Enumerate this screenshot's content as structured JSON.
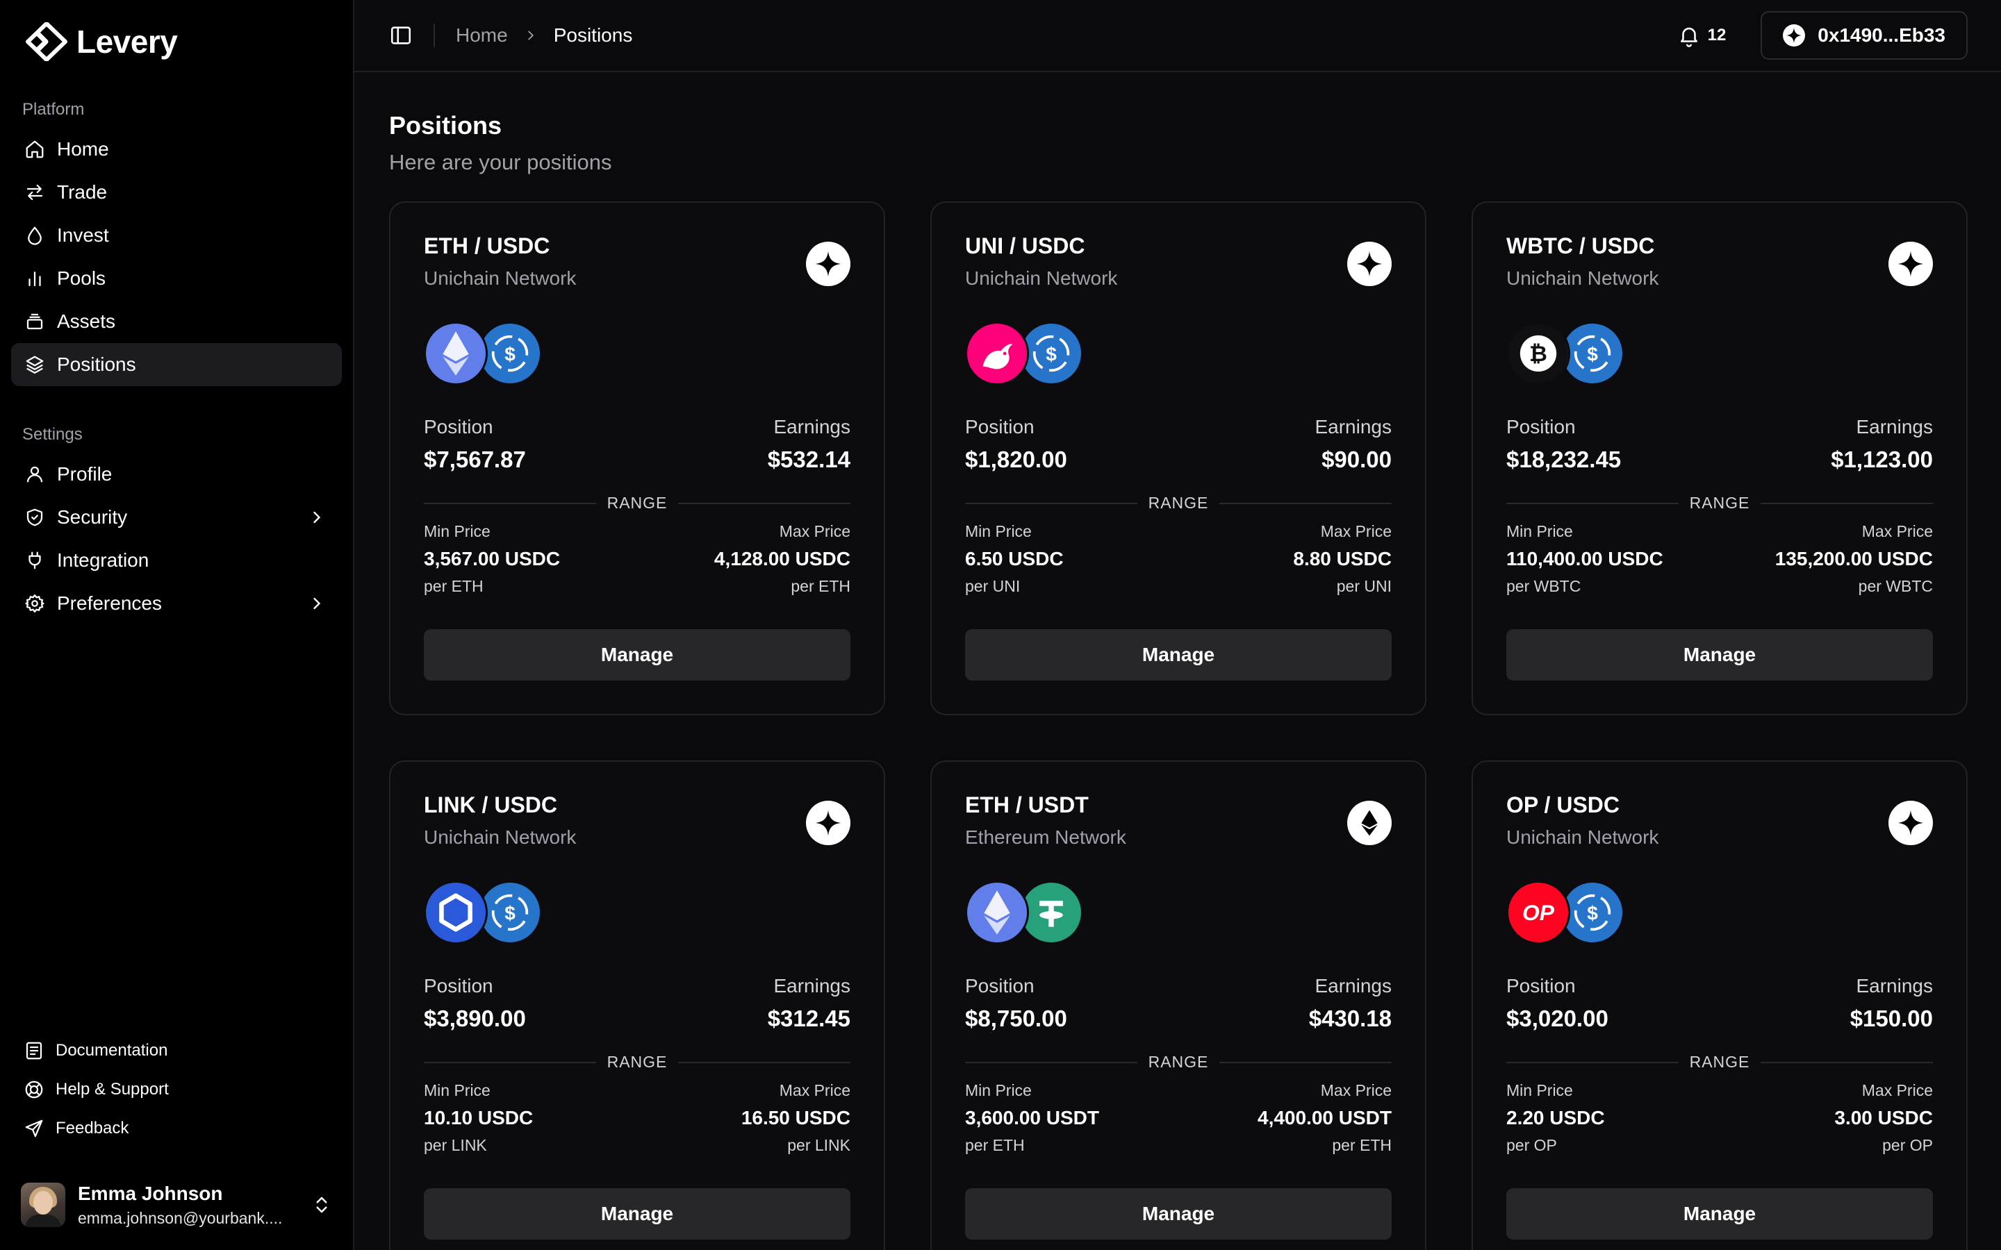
{
  "app": {
    "name": "Levery"
  },
  "sidebar": {
    "platform_label": "Platform",
    "platform_items": [
      {
        "label": "Home",
        "icon": "home-icon"
      },
      {
        "label": "Trade",
        "icon": "arrows-swap-icon"
      },
      {
        "label": "Invest",
        "icon": "droplet-icon"
      },
      {
        "label": "Pools",
        "icon": "bar-chart-icon"
      },
      {
        "label": "Assets",
        "icon": "stack-icon"
      },
      {
        "label": "Positions",
        "icon": "layers-icon",
        "active": true
      }
    ],
    "settings_label": "Settings",
    "settings_items": [
      {
        "label": "Profile",
        "icon": "user-icon"
      },
      {
        "label": "Security",
        "icon": "shield-icon",
        "has_submenu": true
      },
      {
        "label": "Integration",
        "icon": "plug-icon"
      },
      {
        "label": "Preferences",
        "icon": "gear-icon",
        "has_submenu": true
      }
    ],
    "footer_links": [
      {
        "label": "Documentation",
        "icon": "document-icon"
      },
      {
        "label": "Help & Support",
        "icon": "lifebuoy-icon"
      },
      {
        "label": "Feedback",
        "icon": "send-icon"
      }
    ],
    "user": {
      "name": "Emma Johnson",
      "email": "emma.johnson@yourbank...."
    }
  },
  "topbar": {
    "breadcrumb": [
      "Home",
      "Positions"
    ],
    "notifications_count": "12",
    "wallet_address": "0x1490...Eb33"
  },
  "page": {
    "title": "Positions",
    "subtitle": "Here are your positions"
  },
  "labels": {
    "position": "Position",
    "earnings": "Earnings",
    "range": "RANGE",
    "min_price": "Min Price",
    "max_price": "Max Price",
    "manage": "Manage"
  },
  "positions": [
    {
      "pair": "ETH / USDC",
      "network": "Unichain Network",
      "network_icon": "unichain-icon",
      "tokens": [
        "eth",
        "usdc"
      ],
      "position": "$7,567.87",
      "earnings": "$532.14",
      "min_price": "3,567.00 USDC",
      "min_unit": "per ETH",
      "max_price": "4,128.00 USDC",
      "max_unit": "per ETH"
    },
    {
      "pair": "UNI / USDC",
      "network": "Unichain Network",
      "network_icon": "unichain-icon",
      "tokens": [
        "uni",
        "usdc"
      ],
      "position": "$1,820.00",
      "earnings": "$90.00",
      "min_price": "6.50 USDC",
      "min_unit": "per UNI",
      "max_price": "8.80 USDC",
      "max_unit": "per UNI"
    },
    {
      "pair": "WBTC / USDC",
      "network": "Unichain Network",
      "network_icon": "unichain-icon",
      "tokens": [
        "wbtc",
        "usdc"
      ],
      "position": "$18,232.45",
      "earnings": "$1,123.00",
      "min_price": "110,400.00 USDC",
      "min_unit": "per WBTC",
      "max_price": "135,200.00 USDC",
      "max_unit": "per WBTC"
    },
    {
      "pair": "LINK / USDC",
      "network": "Unichain Network",
      "network_icon": "unichain-icon",
      "tokens": [
        "link",
        "usdc"
      ],
      "position": "$3,890.00",
      "earnings": "$312.45",
      "min_price": "10.10 USDC",
      "min_unit": "per LINK",
      "max_price": "16.50 USDC",
      "max_unit": "per LINK"
    },
    {
      "pair": "ETH / USDT",
      "network": "Ethereum Network",
      "network_icon": "ethereum-icon",
      "tokens": [
        "eth",
        "usdt"
      ],
      "position": "$8,750.00",
      "earnings": "$430.18",
      "min_price": "3,600.00 USDT",
      "min_unit": "per ETH",
      "max_price": "4,400.00 USDT",
      "max_unit": "per ETH"
    },
    {
      "pair": "OP / USDC",
      "network": "Unichain Network",
      "network_icon": "unichain-icon",
      "tokens": [
        "op",
        "usdc"
      ],
      "position": "$3,020.00",
      "earnings": "$150.00",
      "min_price": "2.20 USDC",
      "min_unit": "per OP",
      "max_price": "3.00 USDC",
      "max_unit": "per OP"
    }
  ],
  "colors": {
    "background": "#0a0a0c",
    "sidebar": "#000000",
    "card_border": "#232327",
    "button": "#27272a",
    "muted_text": "#a1a1aa",
    "eth": "#627eea",
    "usdc": "#2775ca",
    "uni": "#ff007a",
    "link": "#2a5ada",
    "usdt": "#26a17b",
    "op": "#ff0420"
  }
}
